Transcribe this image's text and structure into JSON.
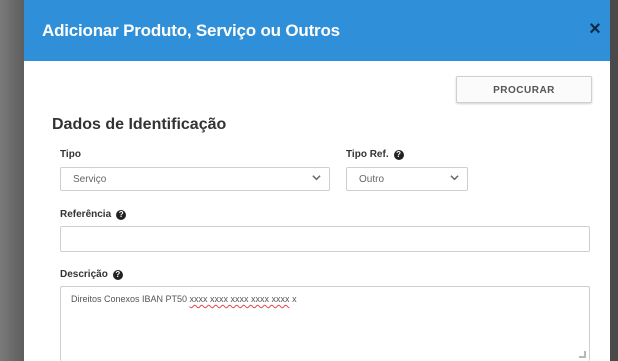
{
  "modal": {
    "title": "Adicionar Produto, Serviço ou Outros",
    "close_icon": "×"
  },
  "toolbar": {
    "search_label": "PROCURAR"
  },
  "section": {
    "title": "Dados de Identificação"
  },
  "fields": {
    "tipo": {
      "label": "Tipo",
      "value": "Serviço"
    },
    "tipo_ref": {
      "label": "Tipo Ref.",
      "value": "Outro"
    },
    "referencia": {
      "label": "Referência",
      "value": ""
    },
    "descricao": {
      "label": "Descrição",
      "value_prefix": "Direitos Conexos IBAN PT50 ",
      "value_misspelled": "xxxx xxxx xxxx xxxx xxxx",
      "value_suffix": " x"
    }
  },
  "icons": {
    "info": "info-icon",
    "dropdown": "chevron-down-icon",
    "close": "close-icon"
  },
  "colors": {
    "header_blue": "#2f8fd8",
    "spellcheck_red": "#e04848"
  }
}
